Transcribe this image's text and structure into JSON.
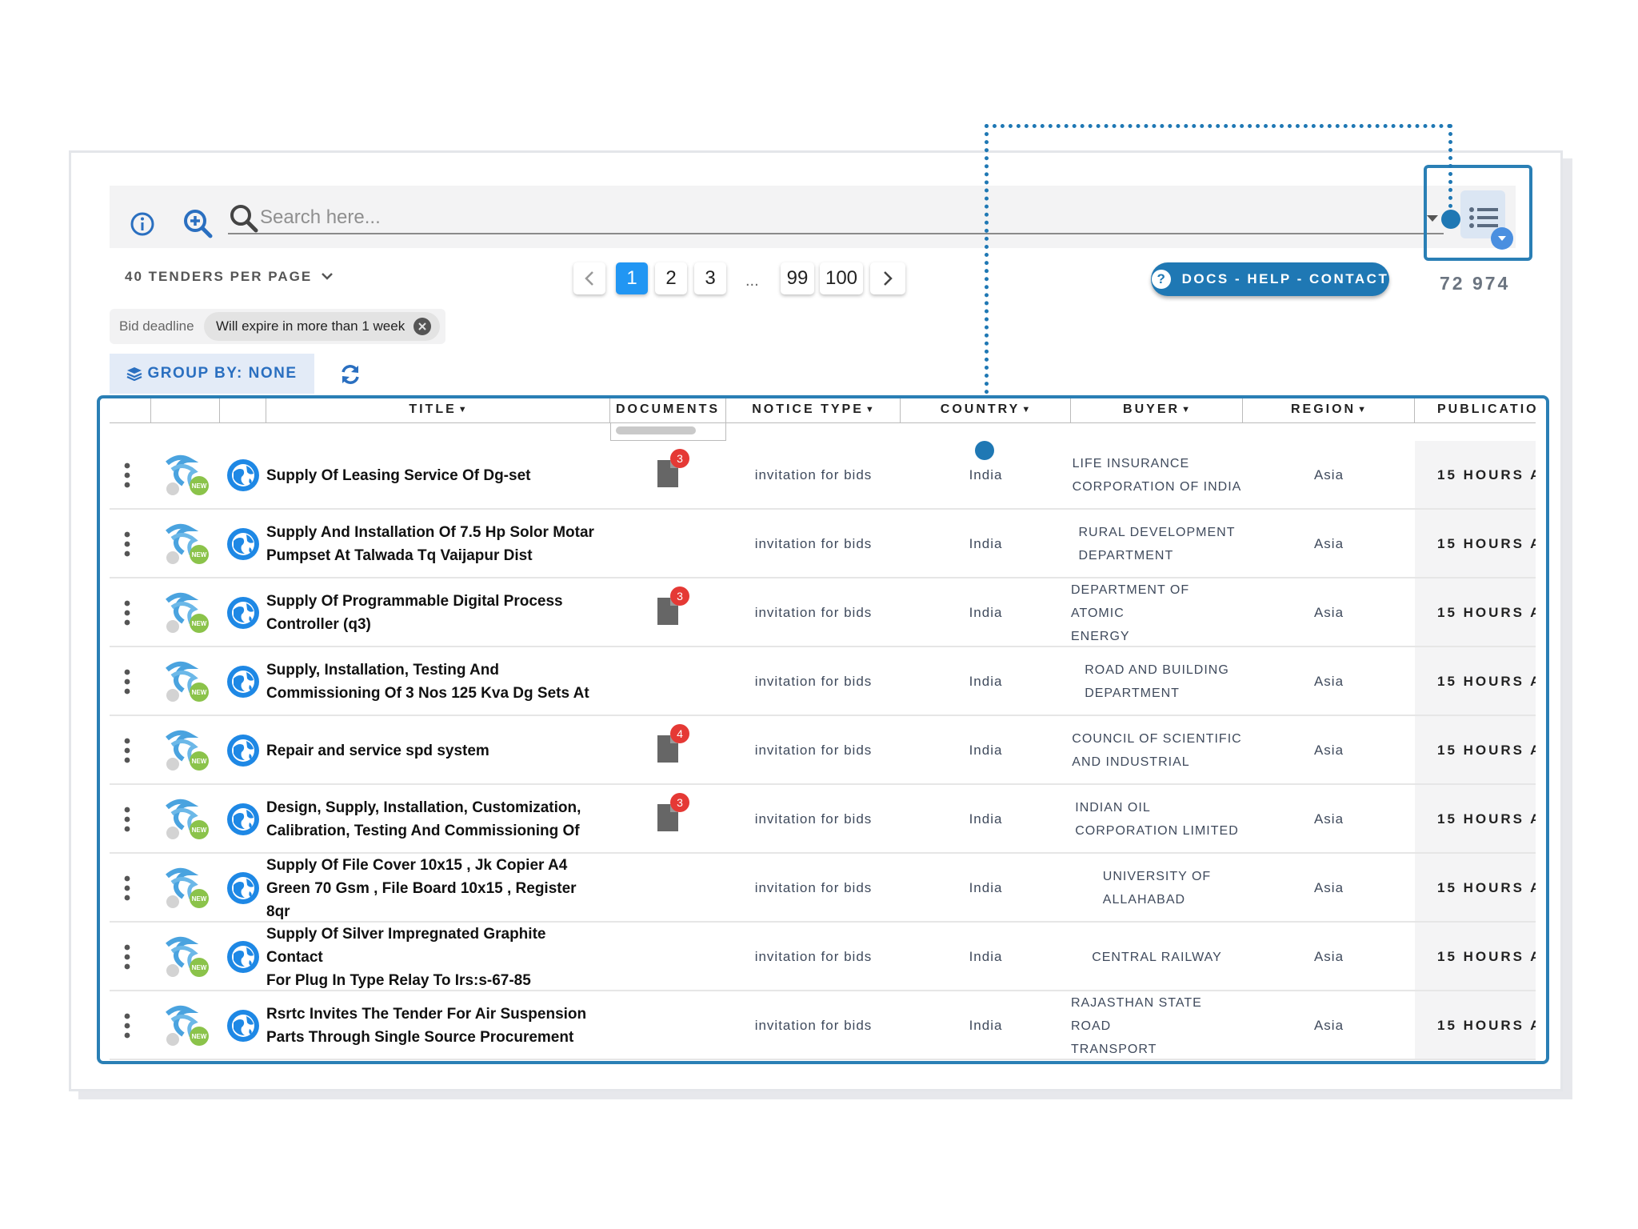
{
  "toolbar": {
    "search_placeholder": "Search here...",
    "info_icon": "info-icon",
    "zoom_icon": "zoom-in-icon",
    "search_icon": "search-icon",
    "columns_icon": "list-columns-icon"
  },
  "pagination": {
    "per_page_label": "40 TENDERS PER PAGE",
    "pages": [
      "1",
      "2",
      "3",
      "99",
      "100"
    ],
    "ellipsis": "...",
    "active_page": "1"
  },
  "help_button": {
    "label": "DOCS - HELP - CONTACT"
  },
  "total_count": "72 974",
  "filter": {
    "label": "Bid deadline",
    "value": "Will expire in more than 1 week"
  },
  "group_by": {
    "label": "GROUP BY: NONE"
  },
  "columns": [
    "TITLE",
    "DOCUMENTS",
    "NOTICE TYPE",
    "COUNTRY",
    "BUYER",
    "REGION",
    "PUBLICATIO"
  ],
  "rows": [
    {
      "title_1": "Supply Of Leasing Service Of Dg-set",
      "title_2": "",
      "docs": "3",
      "notice_type": "invitation for bids",
      "country": "India",
      "buyer_1": "LIFE INSURANCE",
      "buyer_2": "CORPORATION OF INDIA",
      "region": "Asia",
      "publication": "15 HOURS A"
    },
    {
      "title_1": "Supply And Installation Of 7.5 Hp Solor Motar",
      "title_2": "Pumpset At Talwada Tq Vaijapur Dist",
      "docs": "",
      "notice_type": "invitation for bids",
      "country": "India",
      "buyer_1": "RURAL DEVELOPMENT",
      "buyer_2": "DEPARTMENT",
      "region": "Asia",
      "publication": "15 HOURS A"
    },
    {
      "title_1": "Supply Of Programmable Digital Process",
      "title_2": "Controller (q3)",
      "docs": "3",
      "notice_type": "invitation for bids",
      "country": "India",
      "buyer_1": "DEPARTMENT OF ATOMIC",
      "buyer_2": "ENERGY",
      "region": "Asia",
      "publication": "15 HOURS A"
    },
    {
      "title_1": "Supply, Installation, Testing And",
      "title_2": "Commissioning Of 3 Nos 125 Kva Dg Sets At",
      "docs": "",
      "notice_type": "invitation for bids",
      "country": "India",
      "buyer_1": "ROAD AND BUILDING",
      "buyer_2": "DEPARTMENT",
      "region": "Asia",
      "publication": "15 HOURS A"
    },
    {
      "title_1": "Repair and service spd system",
      "title_2": "",
      "docs": "4",
      "notice_type": "invitation for bids",
      "country": "India",
      "buyer_1": "COUNCIL OF SCIENTIFIC",
      "buyer_2": "AND INDUSTRIAL",
      "region": "Asia",
      "publication": "15 HOURS A"
    },
    {
      "title_1": "Design, Supply, Installation, Customization,",
      "title_2": "Calibration, Testing And Commissioning Of",
      "docs": "3",
      "notice_type": "invitation for bids",
      "country": "India",
      "buyer_1": "INDIAN OIL",
      "buyer_2": "CORPORATION LIMITED",
      "region": "Asia",
      "publication": "15 HOURS A"
    },
    {
      "title_1": "Supply Of File Cover 10x15 , Jk Copier A4",
      "title_2": "Green 70 Gsm , File Board 10x15 , Register 8qr",
      "docs": "",
      "notice_type": "invitation for bids",
      "country": "India",
      "buyer_1": "UNIVERSITY OF",
      "buyer_2": "ALLAHABAD",
      "region": "Asia",
      "publication": "15 HOURS A"
    },
    {
      "title_1": "Supply Of Silver Impregnated Graphite Contact",
      "title_2": "For Plug In Type Relay To Irs:s-67-85",
      "docs": "",
      "notice_type": "invitation for bids",
      "country": "India",
      "buyer_1": "CENTRAL RAILWAY",
      "buyer_2": "",
      "region": "Asia",
      "publication": "15 HOURS A"
    },
    {
      "title_1": "Rsrtc Invites The Tender For Air Suspension",
      "title_2": "Parts Through Single Source Procurement",
      "docs": "",
      "notice_type": "invitation for bids",
      "country": "India",
      "buyer_1": "RAJASTHAN STATE ROAD",
      "buyer_2": "TRANSPORT",
      "region": "Asia",
      "publication": "15 HOURS A"
    }
  ],
  "colors": {
    "accent": "#1f78b4",
    "active_page": "#2196f3",
    "badge": "#e53935",
    "new_badge": "#8bc34a"
  }
}
